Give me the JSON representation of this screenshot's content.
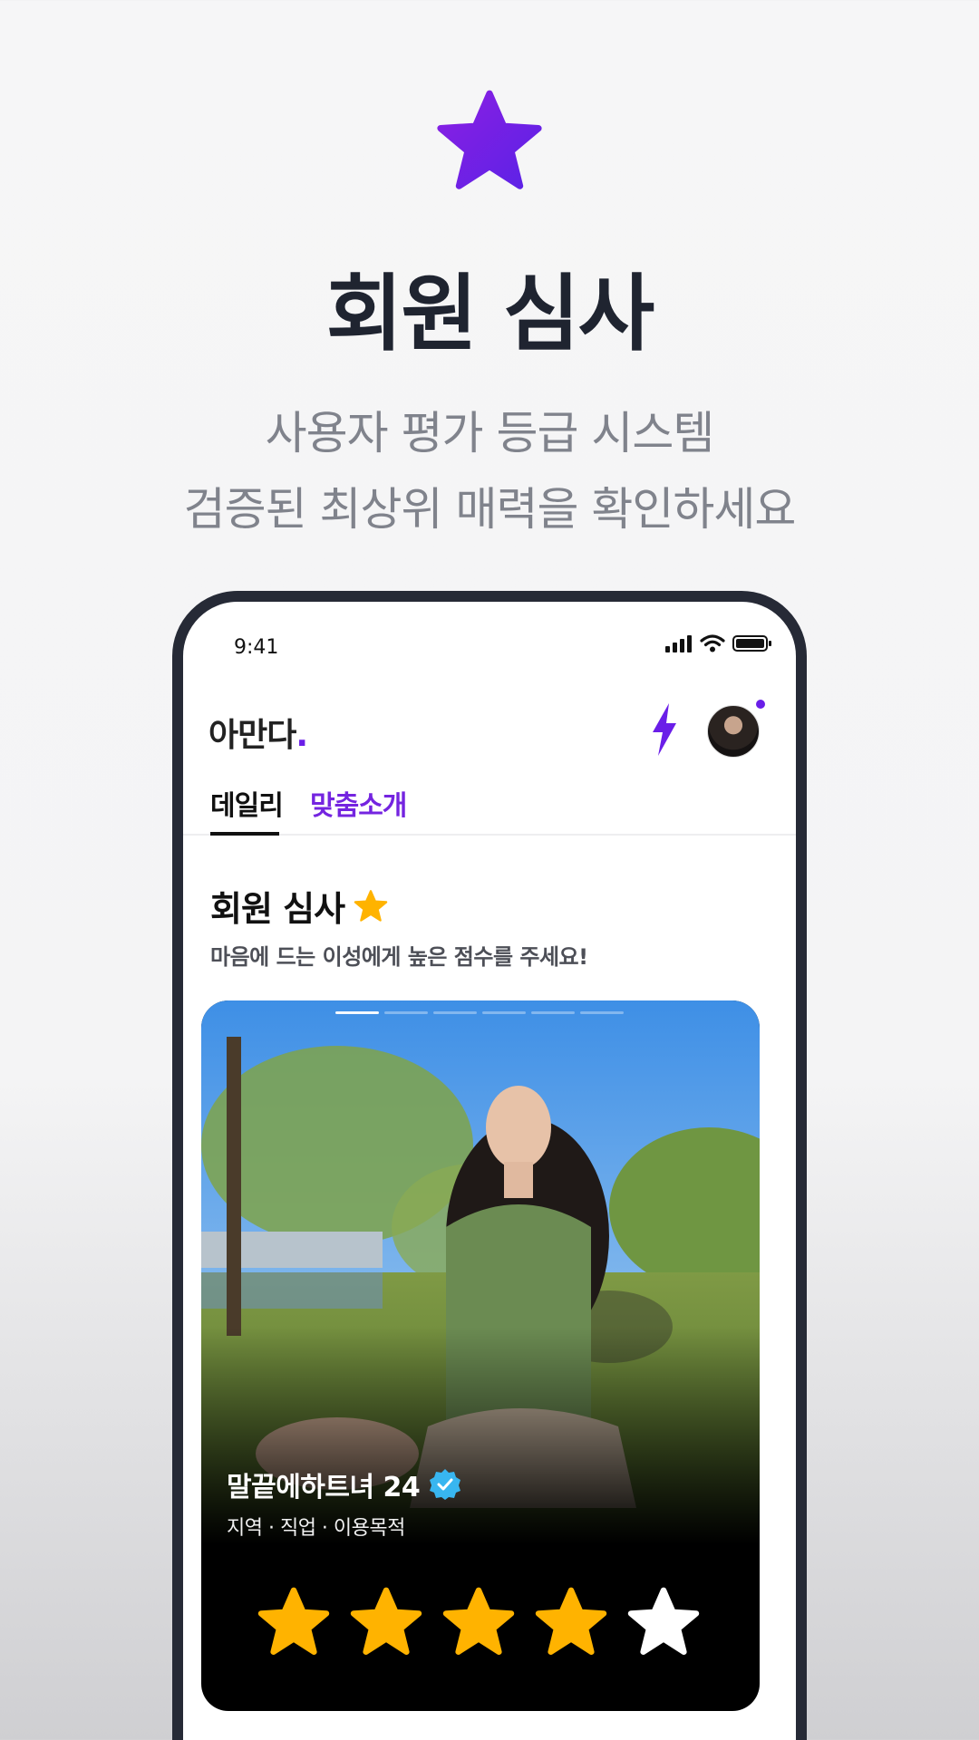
{
  "hero": {
    "title": "회원 심사",
    "subtitle_line1": "사용자 평가 등급 시스템",
    "subtitle_line2": "검증된 최상위 매력을 확인하세요",
    "star_icon": "star-icon",
    "star_colors": [
      "#8b1fe3",
      "#5b22e6"
    ]
  },
  "status_bar": {
    "time": "9:41"
  },
  "app": {
    "logo": "아만다",
    "logo_dot": ".",
    "accent": "#6a1ee8"
  },
  "tabs": [
    {
      "label": "데일리",
      "active": true
    },
    {
      "label": "맞춤소개",
      "active": false
    }
  ],
  "section": {
    "title": "회원 심사",
    "subtitle": "마음에 드는 이성에게 높은 점수를 주세요!"
  },
  "profile": {
    "name_age": "말끝에하트녀 24",
    "meta": "지역 · 직업 · 이용목적",
    "verified_icon": "verified-badge-icon",
    "photo_index": 1,
    "photo_count": 6
  },
  "rating": {
    "max": 5,
    "filled": 4,
    "filled_color": "#ffb300",
    "empty_color": "#ffffff"
  }
}
